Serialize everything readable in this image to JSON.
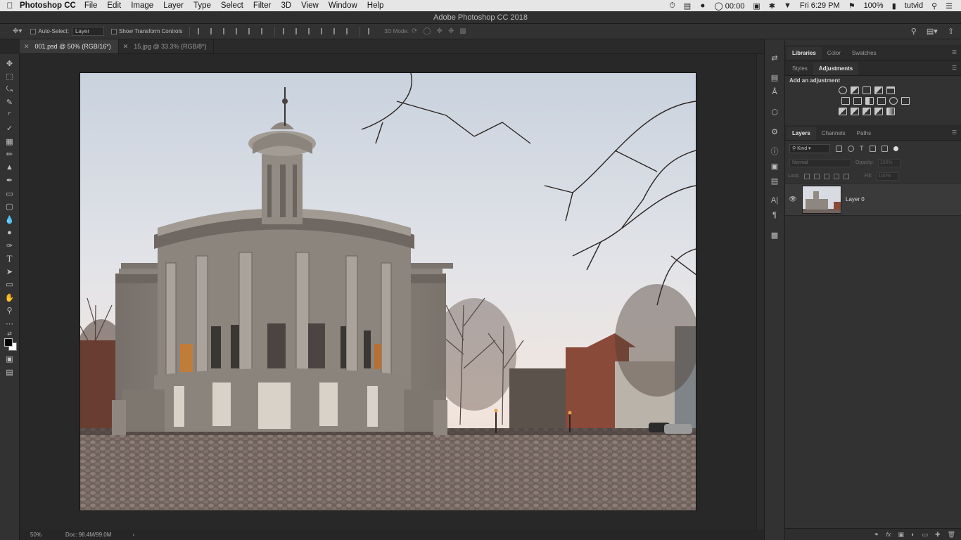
{
  "menubar": {
    "app_name": "Photoshop CC",
    "items": [
      "File",
      "Edit",
      "Image",
      "Layer",
      "Type",
      "Select",
      "Filter",
      "3D",
      "View",
      "Window",
      "Help"
    ],
    "timer": "00:00",
    "clock": "Fri 6:29 PM",
    "battery": "100%",
    "user": "tutvid"
  },
  "window": {
    "title": "Adobe Photoshop CC 2018"
  },
  "options_bar": {
    "auto_select_label": "Auto-Select:",
    "auto_select_value": "Layer",
    "show_transform_label": "Show Transform Controls",
    "mode_3d_label": "3D Mode:"
  },
  "document_tabs": [
    {
      "label": "001.psd @ 50% (RGB/16*)",
      "active": true
    },
    {
      "label": "15.jpg @ 33.3% (RGB/8*)",
      "active": false
    }
  ],
  "status_bar": {
    "zoom": "50%",
    "doc_size": "Doc: 98.4M/99.0M",
    "arrow": "›"
  },
  "panels": {
    "top_tabs": [
      "Libraries",
      "Color",
      "Swatches"
    ],
    "top_active": "Libraries",
    "adj_tabs": [
      "Styles",
      "Adjustments"
    ],
    "adj_active": "Adjustments",
    "adj_title": "Add an adjustment",
    "layer_tabs": [
      "Layers",
      "Channels",
      "Paths"
    ],
    "layer_active": "Layers",
    "kind_filter": "Kind",
    "blend_mode": "Normal",
    "opacity_label": "Opacity:",
    "opacity_value": "100%",
    "lock_label": "Lock:",
    "fill_label": "Fill:",
    "fill_value": "100%",
    "layers": [
      {
        "name": "Layer 0",
        "visible": true
      }
    ]
  }
}
